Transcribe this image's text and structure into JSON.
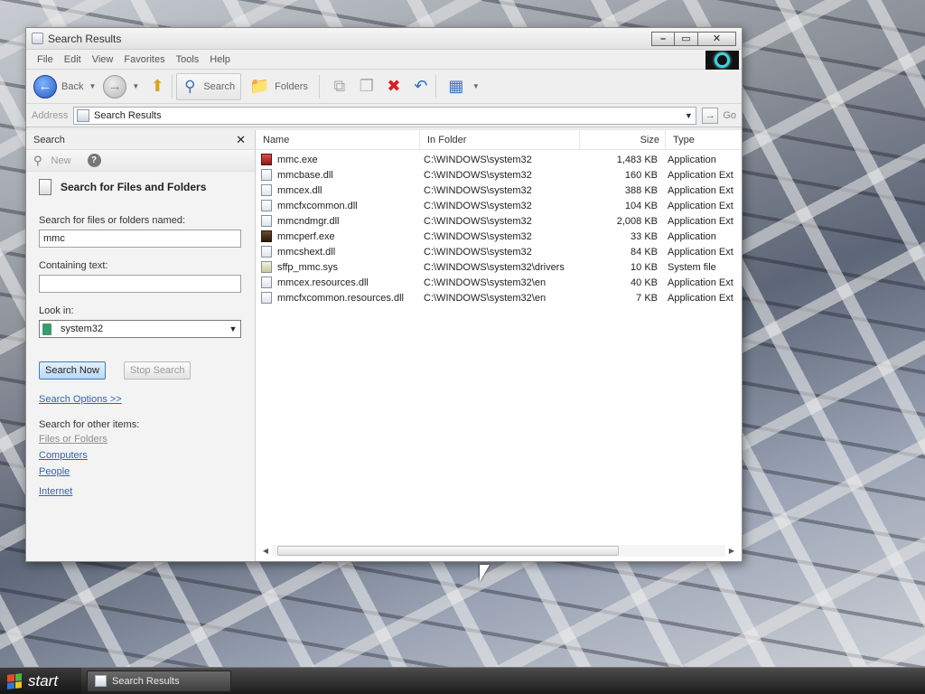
{
  "window": {
    "title": "Search Results",
    "controls": {
      "minimize": "–",
      "maximize": "▭",
      "close": "✕"
    }
  },
  "menu": [
    "File",
    "Edit",
    "View",
    "Favorites",
    "Tools",
    "Help"
  ],
  "toolbar": {
    "back_label": "Back",
    "search_label": "Search",
    "folders_label": "Folders"
  },
  "address": {
    "label": "Address",
    "value": "Search Results",
    "go_label": "Go"
  },
  "search_pane": {
    "header": "Search",
    "new_label": "New",
    "title": "Search for Files and Folders",
    "named_label": "Search for files or folders named:",
    "named_value": "mmc",
    "containing_label": "Containing text:",
    "containing_value": "",
    "look_in_label": "Look in:",
    "look_in_value": "system32",
    "search_now": "Search Now",
    "stop_search": "Stop Search",
    "options_link": "Search Options >>",
    "other_label": "Search for other items:",
    "other_links": {
      "files": "Files or Folders",
      "computers": "Computers",
      "people": "People",
      "internet": "Internet"
    }
  },
  "results": {
    "columns": {
      "name": "Name",
      "folder": "In Folder",
      "size": "Size",
      "type": "Type"
    },
    "rows": [
      {
        "name": "mmc.exe",
        "folder": "C:\\WINDOWS\\system32",
        "size": "1,483 KB",
        "type": "Application",
        "icon": "exe-red"
      },
      {
        "name": "mmcbase.dll",
        "folder": "C:\\WINDOWS\\system32",
        "size": "160 KB",
        "type": "Application Ext",
        "icon": "dll"
      },
      {
        "name": "mmcex.dll",
        "folder": "C:\\WINDOWS\\system32",
        "size": "388 KB",
        "type": "Application Ext",
        "icon": "dll"
      },
      {
        "name": "mmcfxcommon.dll",
        "folder": "C:\\WINDOWS\\system32",
        "size": "104 KB",
        "type": "Application Ext",
        "icon": "dll"
      },
      {
        "name": "mmcndmgr.dll",
        "folder": "C:\\WINDOWS\\system32",
        "size": "2,008 KB",
        "type": "Application Ext",
        "icon": "dll"
      },
      {
        "name": "mmcperf.exe",
        "folder": "C:\\WINDOWS\\system32",
        "size": "33 KB",
        "type": "Application",
        "icon": "exe-dark"
      },
      {
        "name": "mmcshext.dll",
        "folder": "C:\\WINDOWS\\system32",
        "size": "84 KB",
        "type": "Application Ext",
        "icon": "dll"
      },
      {
        "name": "sffp_mmc.sys",
        "folder": "C:\\WINDOWS\\system32\\drivers",
        "size": "10 KB",
        "type": "System file",
        "icon": "sys"
      },
      {
        "name": "mmcex.resources.dll",
        "folder": "C:\\WINDOWS\\system32\\en",
        "size": "40 KB",
        "type": "Application Ext",
        "icon": "dll"
      },
      {
        "name": "mmcfxcommon.resources.dll",
        "folder": "C:\\WINDOWS\\system32\\en",
        "size": "7 KB",
        "type": "Application Ext",
        "icon": "dll"
      }
    ]
  },
  "taskbar": {
    "start_label": "start",
    "task_label": "Search Results"
  }
}
